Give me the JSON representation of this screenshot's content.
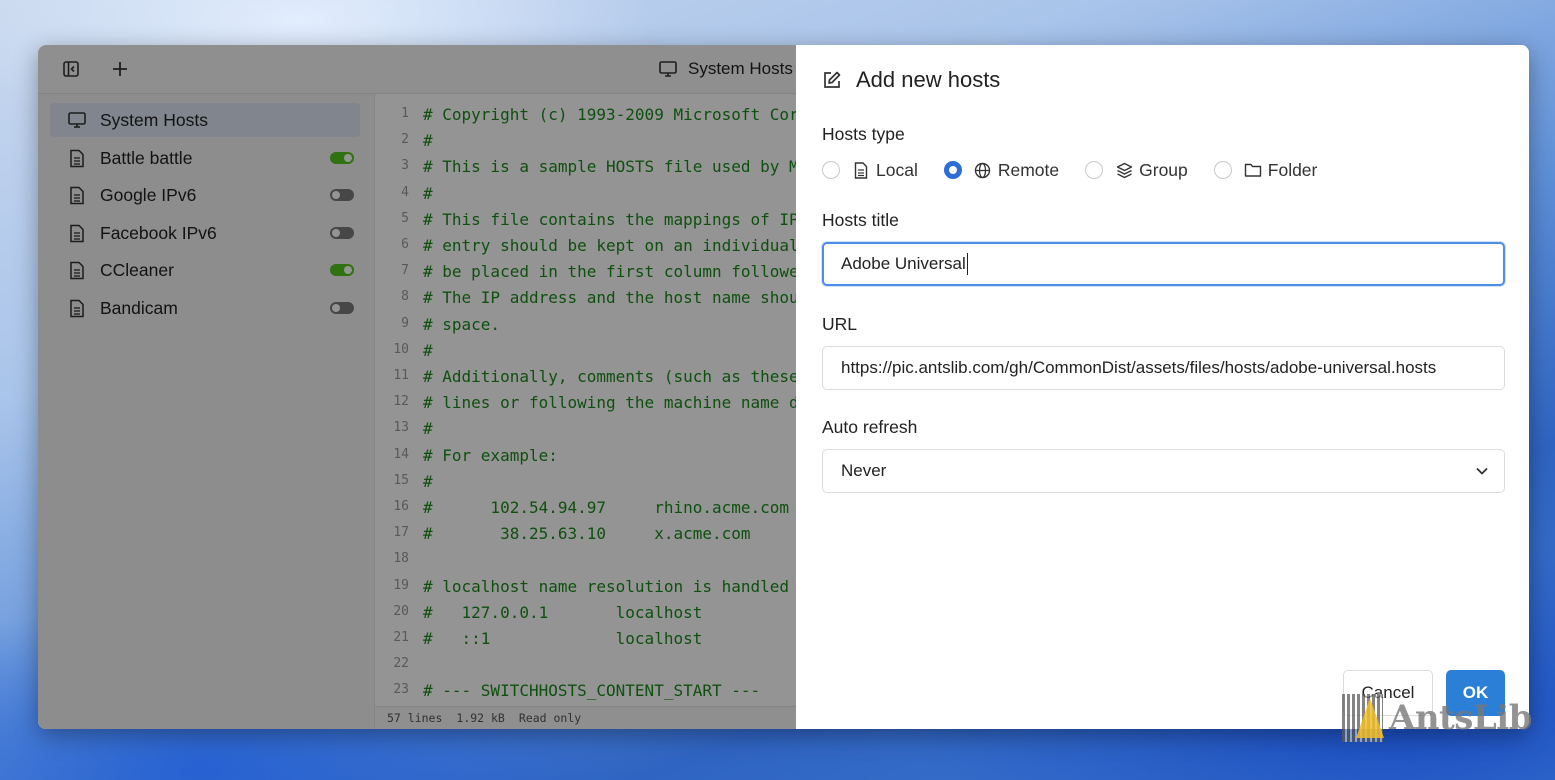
{
  "app": {
    "title": "System Hosts",
    "toolbar": {
      "sidebar_toggle_icon": "sidebar-collapse-icon",
      "add_icon": "plus-icon"
    }
  },
  "sidebar": {
    "items": [
      {
        "label": "System Hosts",
        "icon": "monitor-icon",
        "active": true
      },
      {
        "label": "Battle battle",
        "icon": "file-icon",
        "enabled": true
      },
      {
        "label": "Google IPv6",
        "icon": "file-icon",
        "enabled": false
      },
      {
        "label": "Facebook IPv6",
        "icon": "file-icon",
        "enabled": false
      },
      {
        "label": "CCleaner",
        "icon": "file-icon",
        "enabled": true
      },
      {
        "label": "Bandicam",
        "icon": "file-icon",
        "enabled": false
      }
    ]
  },
  "editor": {
    "lines": [
      {
        "n": "1",
        "text": "# Copyright (c) 1993-2009 Microsoft Cor"
      },
      {
        "n": "2",
        "text": "#"
      },
      {
        "n": "3",
        "text": "# This is a sample HOSTS file used by M"
      },
      {
        "n": "4",
        "text": "#"
      },
      {
        "n": "5",
        "text": "# This file contains the mappings of IP"
      },
      {
        "n": "6",
        "text": "# entry should be kept on an individual"
      },
      {
        "n": "7",
        "text": "# be placed in the first column followe"
      },
      {
        "n": "8",
        "text": "# The IP address and the host name shou"
      },
      {
        "n": "9",
        "text": "# space."
      },
      {
        "n": "10",
        "text": "#"
      },
      {
        "n": "11",
        "text": "# Additionally, comments (such as these"
      },
      {
        "n": "12",
        "text": "# lines or following the machine name d"
      },
      {
        "n": "13",
        "text": "#"
      },
      {
        "n": "14",
        "text": "# For example:"
      },
      {
        "n": "15",
        "text": "#"
      },
      {
        "n": "16",
        "text": "#      102.54.94.97     rhino.acme.com"
      },
      {
        "n": "17",
        "text": "#       38.25.63.10     x.acme.com"
      },
      {
        "n": "18",
        "text": ""
      },
      {
        "n": "19",
        "text": "# localhost name resolution is handled"
      },
      {
        "n": "20",
        "text": "#   127.0.0.1       localhost"
      },
      {
        "n": "21",
        "text": "#   ::1             localhost"
      },
      {
        "n": "22",
        "text": ""
      },
      {
        "n": "23",
        "text": "# --- SWITCHHOSTS_CONTENT_START ---"
      }
    ],
    "status": {
      "lines": "57 lines",
      "size": "1.92 kB",
      "mode": "Read only"
    }
  },
  "dialog": {
    "title": "Add new hosts",
    "title_icon": "edit-icon",
    "hosts_type_label": "Hosts type",
    "hosts_type_options": [
      {
        "label": "Local",
        "icon": "file-icon",
        "checked": false
      },
      {
        "label": "Remote",
        "icon": "globe-icon",
        "checked": true
      },
      {
        "label": "Group",
        "icon": "layers-icon",
        "checked": false
      },
      {
        "label": "Folder",
        "icon": "folder-icon",
        "checked": false
      }
    ],
    "hosts_title_label": "Hosts title",
    "hosts_title_value": "Adobe Universal",
    "url_label": "URL",
    "url_value": "https://pic.antslib.com/gh/CommonDist/assets/files/hosts/adobe-universal.hosts",
    "auto_refresh_label": "Auto refresh",
    "auto_refresh_value": "Never",
    "cancel_label": "Cancel",
    "ok_label": "OK"
  },
  "watermark": {
    "text": "AntsLib"
  },
  "colors": {
    "accent": "#2b7fd6",
    "toggle_on": "#52c41a",
    "code_comment": "#1a8a1a"
  }
}
